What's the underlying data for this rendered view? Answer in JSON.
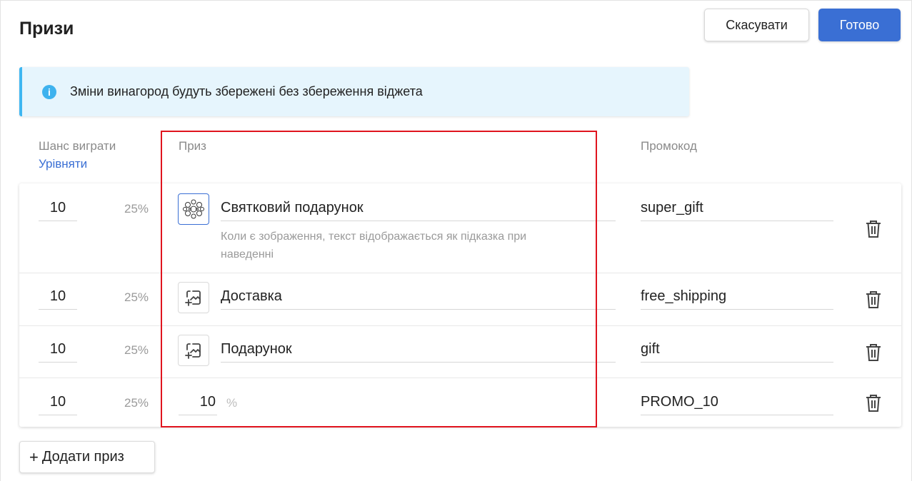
{
  "header": {
    "title": "Призи",
    "cancel_label": "Скасувати",
    "done_label": "Готово"
  },
  "info": {
    "icon": "info-icon",
    "message": "Зміни винагород будуть збережені без збереження віджета"
  },
  "columns": {
    "chance": "Шанс виграти",
    "equalize": "Урівняти",
    "prize": "Приз",
    "promo": "Промокод"
  },
  "rows": [
    {
      "chance": "10",
      "percent": "25%",
      "thumb": "gift-image",
      "name": "Святковий подарунок",
      "hint": "Коли є зображення, текст відображається як підказка при наведенні",
      "promo": "super_gift"
    },
    {
      "chance": "10",
      "percent": "25%",
      "thumb": "add-image-icon",
      "name": "Доставка",
      "promo": "free_shipping"
    },
    {
      "chance": "10",
      "percent": "25%",
      "thumb": "add-image-icon",
      "name": "Подарунок",
      "promo": "gift"
    },
    {
      "chance": "10",
      "percent": "25%",
      "discount": "10",
      "discount_unit": "%",
      "promo": "PROMO_10"
    }
  ],
  "add_prize_label": "Додати приз",
  "colors": {
    "primary": "#3a6fd4",
    "info_accent": "#3eb6f1",
    "highlight": "#e0141e"
  }
}
